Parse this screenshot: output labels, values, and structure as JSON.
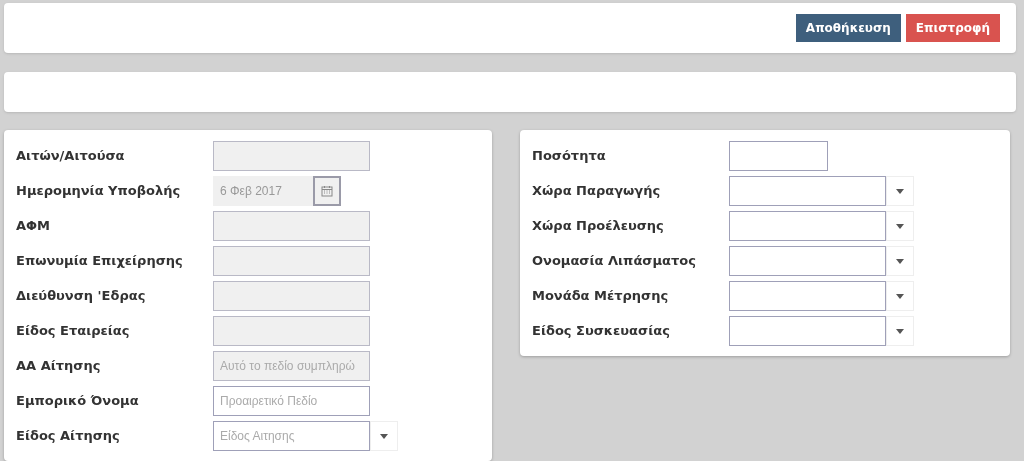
{
  "toolbar": {
    "buttons": [
      {
        "label": "Αποθήκευση",
        "kind": "primary"
      },
      {
        "label": "Επιστροφή",
        "kind": "danger"
      }
    ]
  },
  "left_form": {
    "fields": [
      {
        "label": "Αιτών/Αιτούσα",
        "kind": "text",
        "disabled": true
      },
      {
        "label": "Ημερομηνία Υποβολής",
        "kind": "date",
        "disabled": true,
        "value": "6 Φεβ 2017"
      },
      {
        "label": "ΑΦΜ",
        "kind": "text",
        "disabled": true
      },
      {
        "label": "Επωνυμία Επιχείρησης",
        "kind": "text",
        "disabled": true
      },
      {
        "label": "Διεύθυνση 'Εδρας",
        "kind": "text",
        "disabled": true
      },
      {
        "label": "Είδος Εταιρείας",
        "kind": "text",
        "disabled": true
      },
      {
        "label": "ΑΑ Αίτησης",
        "kind": "text",
        "disabled": true,
        "placeholder": "Αυτό το πεδίο συμπληρώ"
      },
      {
        "label": "Εμπορικό Όνομα",
        "kind": "text",
        "disabled": false,
        "placeholder": "Προαιρετικό Πεδίο"
      },
      {
        "label": "Είδος Αίτησης",
        "kind": "select",
        "disabled": false,
        "placeholder": "Είδος Αιτησης"
      }
    ]
  },
  "right_form": {
    "fields": [
      {
        "label": "Ποσότητα",
        "kind": "short",
        "disabled": false
      },
      {
        "label": "Χώρα Παραγωγής",
        "kind": "select",
        "disabled": false
      },
      {
        "label": "Χώρα Προέλευσης",
        "kind": "select",
        "disabled": false
      },
      {
        "label": "Ονομασία Λιπάσματος",
        "kind": "select",
        "disabled": false
      },
      {
        "label": "Μονάδα Μέτρησης",
        "kind": "select",
        "disabled": false
      },
      {
        "label": "Είδος Συσκευασίας",
        "kind": "select",
        "disabled": false
      }
    ]
  }
}
